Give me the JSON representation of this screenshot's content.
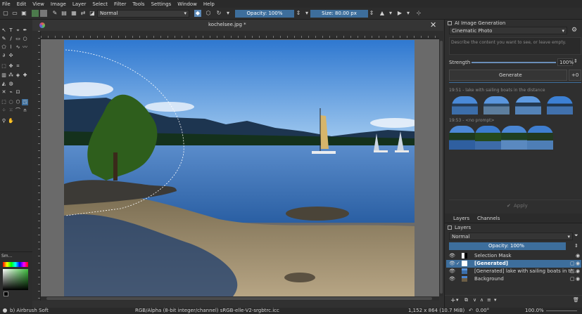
{
  "menu": [
    "File",
    "Edit",
    "View",
    "Image",
    "Layer",
    "Select",
    "Filter",
    "Tools",
    "Settings",
    "Window",
    "Help"
  ],
  "toolbar": {
    "blend_mode": "Normal",
    "opacity_label": "Opacity: 100%",
    "size_label": "Size: 80.00 px"
  },
  "document": {
    "tab_title": "kochelsee.jpg *"
  },
  "toolbox_bottom": {
    "docker_title": "Sm..."
  },
  "ai_panel": {
    "title": "AI Image Generation",
    "style": "Cinematic Photo",
    "prompt_placeholder": "Describe the content you want to see, or leave empty.",
    "strength_label": "Strength",
    "strength_value": "100%",
    "generate_label": "Generate",
    "add_label": "+0",
    "history_1": "19:51 - lake with sailing boats in the distance",
    "history_2": "19:53 - <no prompt>",
    "apply_label": "Apply"
  },
  "layers_panel": {
    "tab_layers": "Layers",
    "tab_channels": "Channels",
    "title": "Layers",
    "blend": "Normal",
    "opacity_label": "Opacity: 100%",
    "rows": [
      {
        "name": "Selection Mask"
      },
      {
        "name": "[Generated]"
      },
      {
        "name": "[Generated] lake with sailing boats in th..."
      },
      {
        "name": "Background"
      }
    ]
  },
  "status": {
    "brush": "b) Airbrush Soft",
    "color_info": "RGB/Alpha (8-bit integer/channel)  sRGB-elle-V2-srgbtrc.icc",
    "dimensions": "1,152 x 864 (10.7 MiB)",
    "rotation": "0.00°",
    "zoom": "100.0%"
  }
}
